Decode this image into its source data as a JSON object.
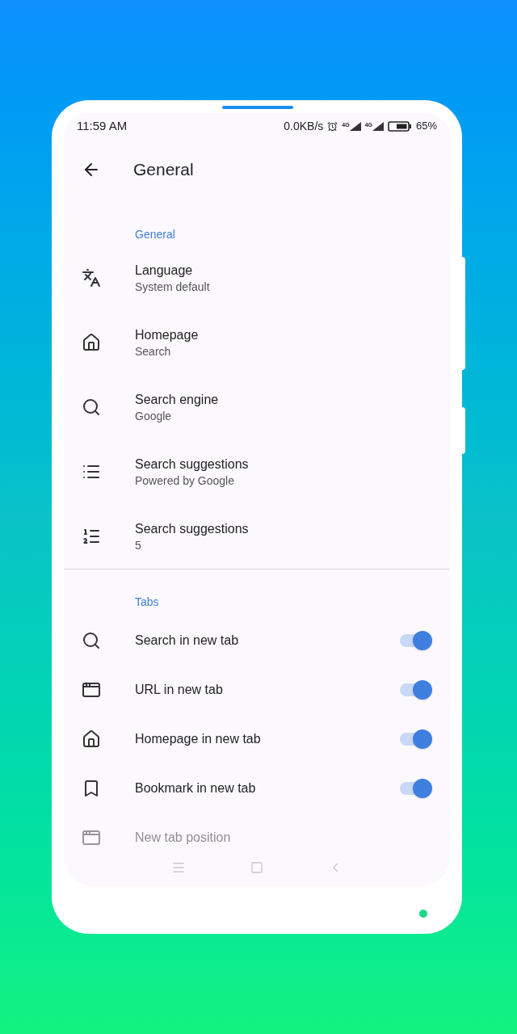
{
  "status_bar": {
    "time": "11:59 AM",
    "network_speed": "0.0KB/s",
    "network_1": "4G",
    "network_2": "4G",
    "battery": "65%"
  },
  "header": {
    "title": "General"
  },
  "sections": [
    {
      "title": "General",
      "items": [
        {
          "kind": "value",
          "label": "Language",
          "value": "System default"
        },
        {
          "kind": "value",
          "label": "Homepage",
          "value": "Search"
        },
        {
          "kind": "value",
          "label": "Search engine",
          "value": "Google"
        },
        {
          "kind": "value",
          "label": "Search suggestions",
          "value": "Powered by Google"
        },
        {
          "kind": "value",
          "label": "Search suggestions",
          "value": "5"
        }
      ]
    },
    {
      "title": "Tabs",
      "items": [
        {
          "kind": "toggle",
          "label": "Search in new tab",
          "on": true
        },
        {
          "kind": "toggle",
          "label": "URL in new tab",
          "on": true
        },
        {
          "kind": "toggle",
          "label": "Homepage in new tab",
          "on": true
        },
        {
          "kind": "toggle",
          "label": "Bookmark in new tab",
          "on": true
        },
        {
          "kind": "value",
          "label": "New tab position"
        }
      ]
    }
  ]
}
